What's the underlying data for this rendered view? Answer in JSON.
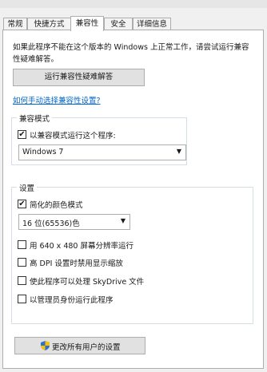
{
  "tabs": [
    "常规",
    "快捷方式",
    "兼容性",
    "安全",
    "详细信息"
  ],
  "intro_text": "如果此程序不能在这个版本的 Windows 上正常工作，请尝试运行兼容性疑难解答。",
  "run_troubleshooter_label": "运行兼容性疑难解答",
  "manual_link": "如何手动选择兼容性设置?",
  "compat_group": {
    "title": "兼容模式",
    "checkbox_label": "以兼容模式运行这个程序:",
    "checked": true,
    "os_value": "Windows 7"
  },
  "settings_group": {
    "title": "设置",
    "reduced_color": {
      "label": "简化的颜色模式",
      "checked": true
    },
    "color_value": "16 位(65536)色",
    "options": [
      {
        "label": "用 640 x 480 屏幕分辨率运行",
        "checked": false
      },
      {
        "label": "高 DPI 设置时禁用显示缩放",
        "checked": false
      },
      {
        "label": "使此程序可以处理 SkyDrive 文件",
        "checked": false
      },
      {
        "label": "以管理员身份运行此程序",
        "checked": false
      }
    ]
  },
  "change_all_users_label": "更改所有用户的设置",
  "colors": {
    "link": "#0066cc",
    "shield_blue": "#2e6fd6",
    "shield_yellow": "#f5c400"
  }
}
